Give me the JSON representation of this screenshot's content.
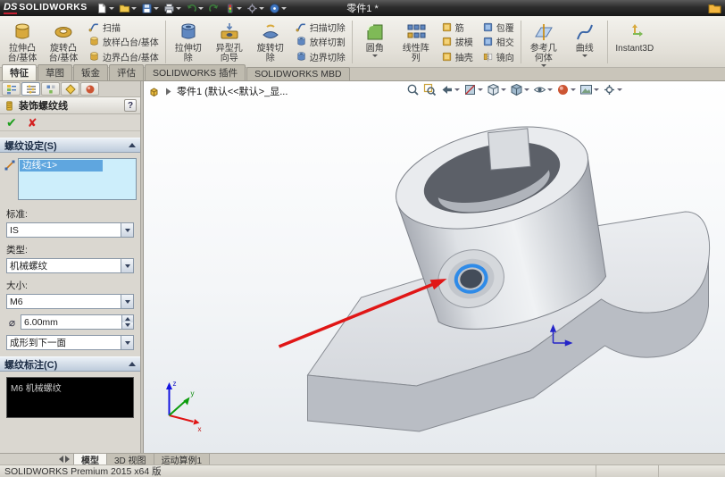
{
  "titlebar": {
    "logo_prefix": "DS",
    "logo_text": "SOLIDWORKS",
    "title": "零件1 *",
    "icon_names": [
      "new",
      "open",
      "save",
      "print",
      "undo",
      "redo",
      "rebuild",
      "options",
      "help"
    ],
    "right_icon": "file-folder"
  },
  "ribbon": {
    "large": [
      {
        "name": "extrude-boss",
        "lines": [
          "拉伸凸",
          "台/基体"
        ]
      },
      {
        "name": "revolve-boss",
        "lines": [
          "旋转凸",
          "台/基体"
        ]
      },
      {
        "name": "extrude-cut",
        "lines": [
          "拉伸切",
          "除"
        ]
      },
      {
        "name": "hole-wizard",
        "lines": [
          "异型孔",
          "向导"
        ]
      },
      {
        "name": "revolve-cut",
        "lines": [
          "旋转切",
          "除"
        ]
      },
      {
        "name": "fillet",
        "lines": [
          "圆角"
        ],
        "dropdown": true
      },
      {
        "name": "linear-pattern",
        "lines": [
          "线性阵",
          "列"
        ],
        "dropdown": true
      },
      {
        "name": "reference-geometry",
        "lines": [
          "参考几",
          "何体"
        ],
        "dropdown": true
      },
      {
        "name": "curves",
        "lines": [
          "曲线"
        ],
        "dropdown": true
      },
      {
        "name": "instant3d",
        "lines": [
          "Instant3D"
        ]
      }
    ],
    "stacks": [
      {
        "items": [
          "扫描",
          "放样凸台/基体",
          "边界凸台/基体"
        ]
      },
      {
        "items": [
          "扫描切除",
          "放样切割",
          "边界切除"
        ]
      },
      {
        "items": [
          "筋",
          "拔模",
          "抽壳"
        ]
      },
      {
        "items": [
          "包覆",
          "相交",
          "镜向"
        ]
      }
    ]
  },
  "command_tabs": [
    "特征",
    "草图",
    "钣金",
    "评估",
    "SOLIDWORKS 插件",
    "SOLIDWORKS MBD"
  ],
  "feature_tree": {
    "root": "零件1 (默认<<默认>_显..."
  },
  "hud_icon_names": [
    "zoom-fit",
    "zoom-to-area",
    "previous-view",
    "section-view",
    "view-orientation",
    "display-style",
    "hide-show-items",
    "edit-appearance",
    "apply-scene",
    "view-settings"
  ],
  "property_manager": {
    "title": "装饰螺纹线",
    "help_glyph": "?",
    "ok_glyph": "✔",
    "cancel_glyph": "✘",
    "groups": {
      "settings": "螺纹设定(S)",
      "callout": "螺纹标注(C)"
    },
    "selection_items": [
      "边线<1>"
    ],
    "standard_label": "标准:",
    "standard_value": "IS",
    "type_label": "类型:",
    "type_value": "机械螺纹",
    "size_label": "大小:",
    "size_value": "M6",
    "diameter_glyph": "⌀",
    "diameter_value": "6.00mm",
    "end_condition_value": "成形到下一面",
    "callout_text": "M6 机械螺纹"
  },
  "triad": {
    "x": "x",
    "y": "y",
    "z": "z"
  },
  "model_tabs": [
    {
      "label": "模型",
      "active": true
    },
    {
      "label": "3D 视图",
      "active": false
    },
    {
      "label": "运动算例1",
      "active": false
    }
  ],
  "statusbar": {
    "text": "SOLIDWORKS Premium 2015 x64 版"
  },
  "colors": {
    "selected_edge": "#2f8be8",
    "annotation_arrow": "#e01616",
    "selection_box_bg": "#cdeefb",
    "titlebar_bg": "#2d2d2d"
  }
}
